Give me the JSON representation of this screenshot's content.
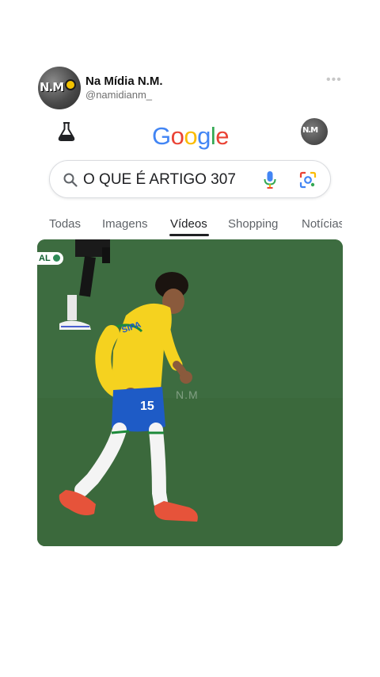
{
  "post": {
    "name": "Na Mídia N.M.",
    "handle": "@namidianm_",
    "avatar_text": "N.M",
    "more": "•••"
  },
  "google": {
    "logo": [
      "G",
      "o",
      "o",
      "g",
      "l",
      "e"
    ],
    "logo_colors": [
      "#4285F4",
      "#EA4335",
      "#FBBC05",
      "#4285F4",
      "#34A853",
      "#EA4335"
    ],
    "search_query": "O QUE É ARTIGO 307",
    "profile_text": "N.M",
    "tabs": [
      {
        "label": "Todas",
        "active": false
      },
      {
        "label": "Imagens",
        "active": false
      },
      {
        "label": "Vídeos",
        "active": true
      },
      {
        "label": "Shopping",
        "active": false
      },
      {
        "label": "Notícias",
        "active": false
      }
    ]
  },
  "video": {
    "badge": "AL",
    "watermark": "N.M",
    "shirt_number": "15",
    "colors": {
      "pitch": "#3c6a3f",
      "shirt": "#f5d21f",
      "shorts": "#1e5bc6",
      "boots": "#e6533a"
    }
  },
  "icons": [
    "labs-flask-icon",
    "search-icon",
    "mic-icon",
    "lens-icon",
    "more-icon"
  ]
}
